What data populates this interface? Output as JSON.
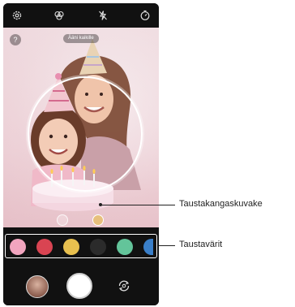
{
  "viewfinder": {
    "help_label": "?",
    "tip_label": "Ääni kaikille"
  },
  "swatches": [
    {
      "name": "pink",
      "color": "#f2a5bf"
    },
    {
      "name": "red",
      "color": "#d94452"
    },
    {
      "name": "yellow",
      "color": "#e8c04f"
    },
    {
      "name": "black",
      "color": "#2b2b2b"
    },
    {
      "name": "green",
      "color": "#63c49a"
    },
    {
      "name": "blue",
      "color": "#3a7fc9"
    }
  ],
  "callouts": {
    "background_image": "Taustakangaskuvake",
    "background_colors": "Taustavärit"
  },
  "icons": {
    "top": [
      "settings-icon",
      "filter-icon",
      "flash-off-icon",
      "timer-icon"
    ],
    "bottom": [
      "gallery-thumbnail",
      "shutter-button",
      "switch-camera-icon"
    ]
  }
}
